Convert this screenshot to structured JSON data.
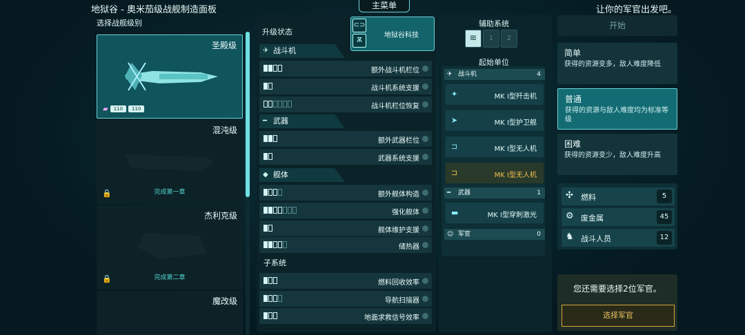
{
  "header": {
    "title": "地狱谷 - 奥米茄级战舰制造面板",
    "main_menu": "主菜单",
    "hint": "让你的军官出发吧。"
  },
  "hull_select": {
    "label": "选择战舰级别",
    "ships": [
      {
        "name": "圣殿级",
        "locked": false,
        "selected": true,
        "badges": [
          "110",
          "110"
        ]
      },
      {
        "name": "混沌级",
        "locked": true,
        "unlock": "完成第一章"
      },
      {
        "name": "杰利克级",
        "locked": true,
        "unlock": "完成第二章"
      },
      {
        "name": "魔改级",
        "locked": true,
        "unlock": ""
      }
    ]
  },
  "upgrades": {
    "label": "升级状态",
    "tech_name": "地狱谷科技",
    "sections": [
      {
        "name": "战斗机",
        "rows": [
          {
            "name": "额外战斗机栏位",
            "on": 2,
            "total": 4
          },
          {
            "name": "战斗机系统支援",
            "on": 1,
            "total": 2
          },
          {
            "name": "战斗机栏位恢复",
            "on": 0,
            "total": 6
          }
        ]
      },
      {
        "name": "武器",
        "rows": [
          {
            "name": "额外武器栏位",
            "on": 2,
            "total": 3
          },
          {
            "name": "武器系统支援",
            "on": 1,
            "total": 2
          }
        ]
      },
      {
        "name": "舰体",
        "rows": [
          {
            "name": "额外舰体构造",
            "on": 1,
            "total": 4
          },
          {
            "name": "强化舰体",
            "on": 2,
            "total": 7
          },
          {
            "name": "舰体维护支援",
            "on": 1,
            "total": 2
          },
          {
            "name": "储热器",
            "on": 2,
            "total": 5
          }
        ]
      },
      {
        "name": "子系统",
        "rows": [
          {
            "name": "燃料回收效率",
            "on": 1,
            "total": 3
          },
          {
            "name": "导航扫描器",
            "on": 1,
            "total": 4
          },
          {
            "name": "地面求救信号效率",
            "on": 1,
            "total": 3
          }
        ]
      }
    ]
  },
  "aux": {
    "label": "辅助系统",
    "slot2": "1",
    "slot3": "2"
  },
  "start_units": {
    "label": "起始单位",
    "fighter_head": {
      "name": "战斗机",
      "count": "4"
    },
    "fighters": [
      "MK I型歼击机",
      "MK I型护卫舰",
      "MK I型无人机",
      "MK I型无人机"
    ],
    "weapon_head": {
      "name": "武器",
      "count": "1"
    },
    "weapons": [
      "MK I型穿刺激光"
    ],
    "officer_head": {
      "name": "军官",
      "count": "0"
    }
  },
  "difficulty": {
    "start": "开始",
    "options": [
      {
        "title": "简单",
        "desc": "获得的资源变多，敌人难度降低"
      },
      {
        "title": "普通",
        "desc": "获得的资源与敌人难度均为标准等级"
      },
      {
        "title": "困难",
        "desc": "获得的资源变少，敌人难度升高"
      }
    ]
  },
  "resources": {
    "fuel": {
      "name": "燃料",
      "value": "5"
    },
    "scrap": {
      "name": "废金属",
      "value": "45"
    },
    "crew": {
      "name": "战斗人员",
      "value": "12"
    }
  },
  "officers": {
    "message": "您还需要选择2位军官。",
    "button": "选择军官"
  }
}
